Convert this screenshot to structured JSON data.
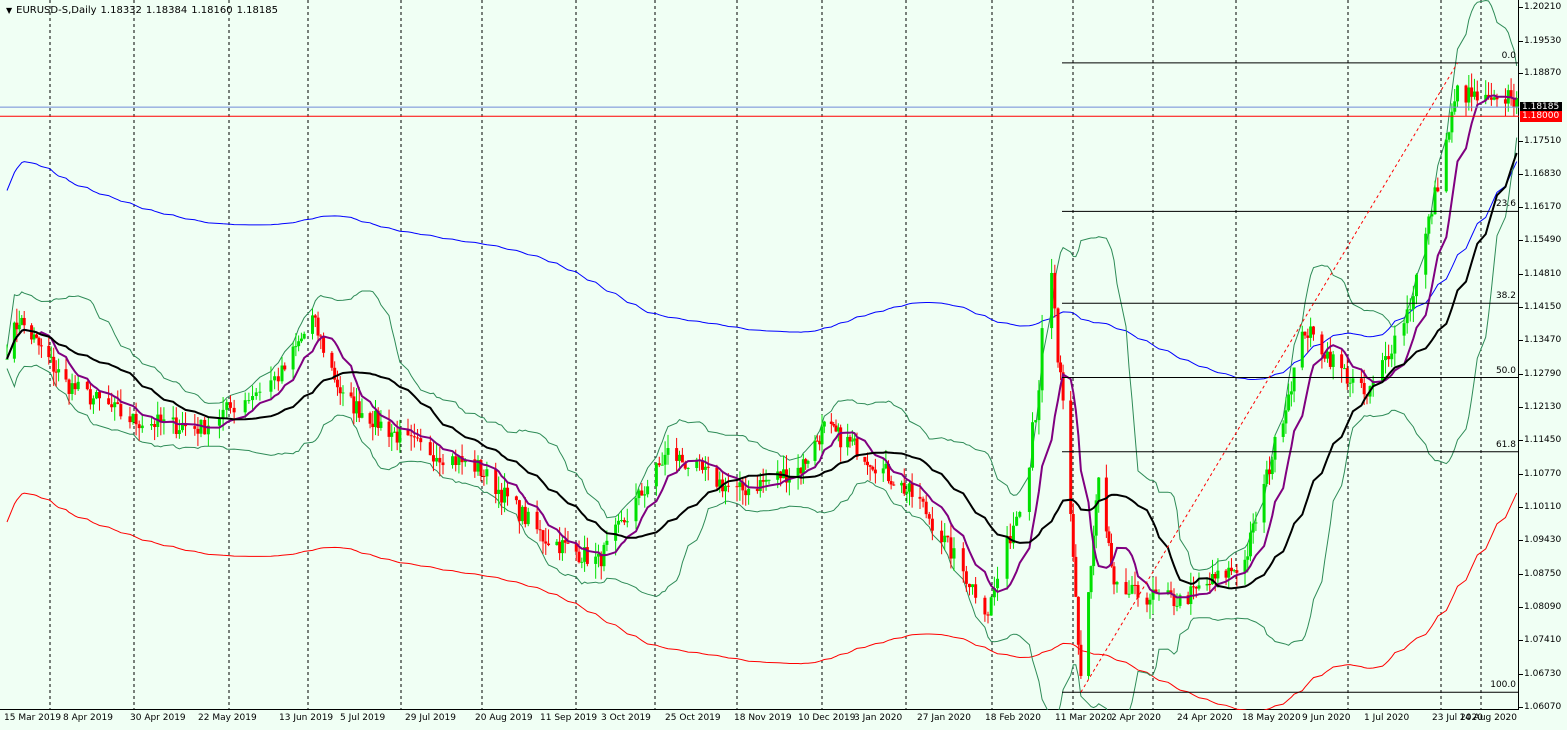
{
  "header": {
    "symbol": "EURUSD-S,Daily",
    "open": "1.18332",
    "high": "1.18384",
    "low": "1.18160",
    "close": "1.18185"
  },
  "price_axis": {
    "labels": [
      "1.20210",
      "1.19530",
      "1.18870",
      "1.17510",
      "1.16830",
      "1.16170",
      "1.15490",
      "1.14810",
      "1.14150",
      "1.13470",
      "1.12790",
      "1.12130",
      "1.11450",
      "1.10770",
      "1.10110",
      "1.09430",
      "1.08750",
      "1.08090",
      "1.07410",
      "1.06730",
      "1.06070"
    ],
    "current_price": "1.18185",
    "alert_price": "1.18000"
  },
  "time_axis": {
    "labels": [
      "15 Mar 2019",
      "8 Apr 2019",
      "30 Apr 2019",
      "22 May 2019",
      "13 Jun 2019",
      "5 Jul 2019",
      "29 Jul 2019",
      "20 Aug 2019",
      "11 Sep 2019",
      "3 Oct 2019",
      "25 Oct 2019",
      "18 Nov 2019",
      "10 Dec 2019",
      "3 Jan 2020",
      "27 Jan 2020",
      "18 Feb 2020",
      "11 Mar 2020",
      "2 Apr 2020",
      "24 Apr 2020",
      "18 May 2020",
      "9 Jun 2020",
      "1 Jul 2020",
      "23 Jul 2020",
      "14 Aug 2020"
    ]
  },
  "fibonacci": {
    "levels": [
      "0.0",
      "23.6",
      "38.2",
      "50.0",
      "61.8",
      "100.0"
    ],
    "low": 1.0636,
    "high": 1.1908
  },
  "colors": {
    "background": "#f0fff4",
    "bull": "#00e000",
    "bear": "#ff0000",
    "fast_ma": "#800080",
    "slow_ma": "#000000",
    "bollinger": "#2e8b57",
    "envelope_upper": "#0000ff",
    "envelope_lower": "#ff0000",
    "current_line": "#6f8bd8",
    "alert_line": "#ff0000"
  },
  "chart_data": {
    "type": "candlestick",
    "y_range": [
      1.06,
      1.2035
    ],
    "price_trajectory": [
      [
        "15 Mar 2019",
        1.133
      ],
      [
        "20 Mar 2019",
        1.139
      ],
      [
        "8 Apr 2019",
        1.126
      ],
      [
        "30 Apr 2019",
        1.1185
      ],
      [
        "22 May 2019",
        1.117
      ],
      [
        "13 Jun 2019",
        1.128
      ],
      [
        "24 Jun 2019",
        1.139
      ],
      [
        "5 Jul 2019",
        1.123
      ],
      [
        "29 Jul 2019",
        1.114
      ],
      [
        "20 Aug 2019",
        1.109
      ],
      [
        "11 Sep 2019",
        1.095
      ],
      [
        "1 Oct 2019",
        1.09
      ],
      [
        "25 Oct 2019",
        1.112
      ],
      [
        "18 Nov 2019",
        1.104
      ],
      [
        "10 Dec 2019",
        1.109
      ],
      [
        "20 Dec 2019",
        1.117
      ],
      [
        "3 Jan 2020",
        1.113
      ],
      [
        "27 Jan 2020",
        1.102
      ],
      [
        "18 Feb 2020",
        1.08
      ],
      [
        "28 Feb 2020",
        1.102
      ],
      [
        "9 Mar 2020",
        1.145
      ],
      [
        "20 Mar 2020",
        1.068
      ],
      [
        "27 Mar 2020",
        1.105
      ],
      [
        "2 Apr 2020",
        1.084
      ],
      [
        "24 Apr 2020",
        1.082
      ],
      [
        "18 May 2020",
        1.09
      ],
      [
        "9 Jun 2020",
        1.137
      ],
      [
        "1 Jul 2020",
        1.123
      ],
      [
        "15 Jul 2020",
        1.142
      ],
      [
        "23 Jul 2020",
        1.164
      ],
      [
        "31 Jul 2020",
        1.185
      ],
      [
        "14 Aug 2020",
        1.182
      ],
      [
        "19 Aug 2020",
        1.185
      ],
      [
        "21 Aug 2020",
        1.1819
      ]
    ]
  }
}
